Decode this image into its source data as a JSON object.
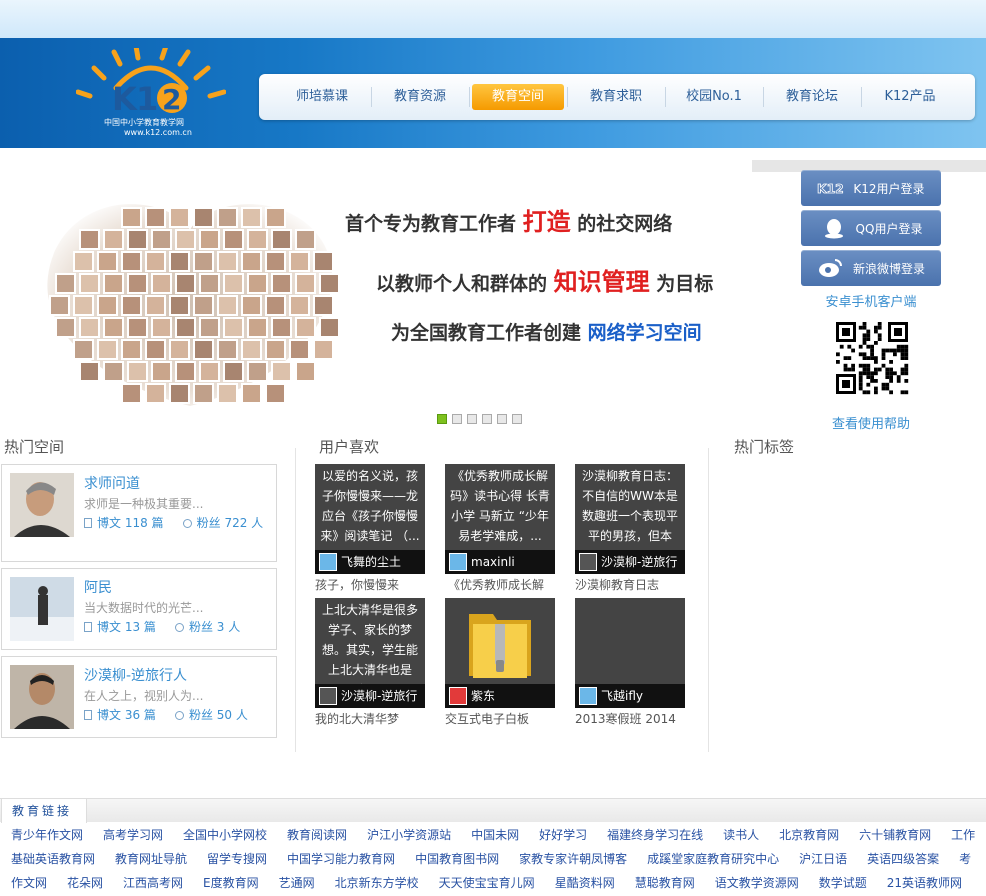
{
  "logo": {
    "sub": "中国中小学教育教学网",
    "url": "www.k12.com.cn"
  },
  "nav": [
    "师培慕课",
    "教育资源",
    "教育空间",
    "教育求职",
    "校园No.1",
    "教育论坛",
    "K12产品"
  ],
  "nav_active": 2,
  "banner": {
    "line1_a": "首个专为教育工作者",
    "line1_hl": "打造",
    "line1_b": "的社交网络",
    "line2_a": "以教师个人和群体的",
    "line2_hl": "知识管理",
    "line2_b": "为目标",
    "line3_a": "为全国教育工作者创建",
    "line3_hl": "网络学习空间"
  },
  "login": {
    "k12": "K12用户登录",
    "qq": "QQ用户登录",
    "weibo": "新浪微博登录",
    "android": "安卓手机客户端",
    "help": "查看使用帮助"
  },
  "sections": {
    "hot_spaces": "热门空间",
    "user_likes": "用户喜欢",
    "hot_tags": "热门标签"
  },
  "hot_spaces": [
    {
      "name": "求师问道",
      "desc": "求师是一种极其重要...",
      "posts": "博文 118 篇",
      "fans": "粉丝 722 人"
    },
    {
      "name": "阿民",
      "desc": "当大数据时代的光芒...",
      "posts": "博文 13 篇",
      "fans": "粉丝 3 人"
    },
    {
      "name": "沙漠柳-逆旅行人",
      "desc": "在人之上，视别人为...",
      "posts": "博文 36 篇",
      "fans": "粉丝 50 人"
    }
  ],
  "likes": [
    {
      "text": "以爱的名义说，孩子你慢慢来——龙应台《孩子你慢慢来》阅读笔记 （...",
      "user": "飞舞的尘土",
      "caption": "孩子，你慢慢来"
    },
    {
      "text": "《优秀教师成长解码》读书心得 长青小学 马新立 “少年易老学难成，...",
      "user": "maxinli",
      "caption": "《优秀教师成长解"
    },
    {
      "text": "沙漠柳教育日志：不自信的WW本是数趣班一个表现平平的男孩，但本期...",
      "user": "沙漠柳-逆旅行",
      "caption": "沙漠柳教育日志"
    },
    {
      "text": "上北大清华是很多学子、家长的梦想。其实，学生能上北大清华也是很...",
      "user": "沙漠柳-逆旅行",
      "caption": "我的北大清华梦"
    },
    {
      "text": "",
      "user": "紫东",
      "caption": "交互式电子白板"
    },
    {
      "text": "",
      "user": "飞越ifly",
      "caption": "2013寒假班 2014"
    }
  ],
  "links_title": "教育链接",
  "links": [
    [
      "青少年作文网",
      "高考学习网",
      "全国中小学网校",
      "教育阅读网",
      "沪江小学资源站",
      "中国未网",
      "好好学习",
      "福建终身学习在线",
      "读书人",
      "北京教育网",
      "六十铺教育网",
      "工作"
    ],
    [
      "基础英语教育网",
      "教育网址导航",
      "留学专搜网",
      "中国学习能力教育网",
      "中国教育图书网",
      "家教专家许朝凤博客",
      "成蹊堂家庭教育研究中心",
      "沪江日语",
      "英语四级答案",
      "考"
    ],
    [
      "作文网",
      "花朵网",
      "江西高考网",
      "E度教育网",
      "艺通网",
      "北京新东方学校",
      "天天使宝宝育儿网",
      "星酷资料网",
      "慧聪教育网",
      "语文教学资源网",
      "数学试题",
      "21英语教师网"
    ]
  ]
}
